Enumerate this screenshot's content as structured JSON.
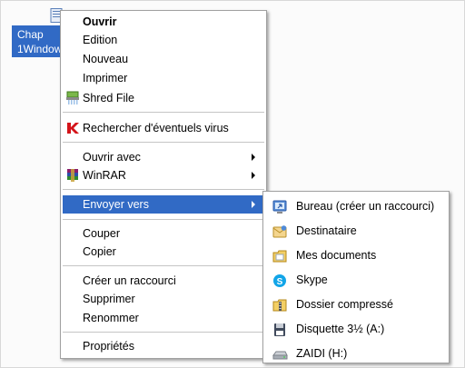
{
  "desktop_file": {
    "label_line1": "Chap",
    "label_line2": "1Window",
    "icon": "document-icon"
  },
  "context_menu": {
    "items": [
      {
        "label": "Ouvrir",
        "bold": true
      },
      {
        "label": "Edition"
      },
      {
        "label": "Nouveau"
      },
      {
        "label": "Imprimer"
      },
      {
        "label": "Shred File",
        "icon": "shredder-icon"
      },
      {
        "label": "Rechercher d'éventuels virus",
        "icon": "kaspersky-icon"
      },
      {
        "label": "Ouvrir avec",
        "submenu": true
      },
      {
        "label": "WinRAR",
        "icon": "winrar-icon",
        "submenu": true
      },
      {
        "label": "Envoyer vers",
        "submenu": true,
        "selected": true
      },
      {
        "label": "Couper"
      },
      {
        "label": "Copier"
      },
      {
        "label": "Créer un raccourci"
      },
      {
        "label": "Supprimer"
      },
      {
        "label": "Renommer"
      },
      {
        "label": "Propriétés"
      }
    ]
  },
  "send_to_menu": {
    "items": [
      {
        "label": "Bureau (créer un raccourci)",
        "icon": "desktop-icon"
      },
      {
        "label": "Destinataire",
        "icon": "mail-recipient-icon"
      },
      {
        "label": "Mes documents",
        "icon": "my-documents-icon"
      },
      {
        "label": "Skype",
        "icon": "skype-icon"
      },
      {
        "label": "Dossier compressé",
        "icon": "zip-folder-icon"
      },
      {
        "label": "Disquette 3½ (A:)",
        "icon": "floppy-icon"
      },
      {
        "label": "ZAIDI (H:)",
        "icon": "drive-icon"
      }
    ]
  },
  "colors": {
    "selection": "#316ac5",
    "menu_background": "#ffffff",
    "separator": "#c5c5c5"
  }
}
